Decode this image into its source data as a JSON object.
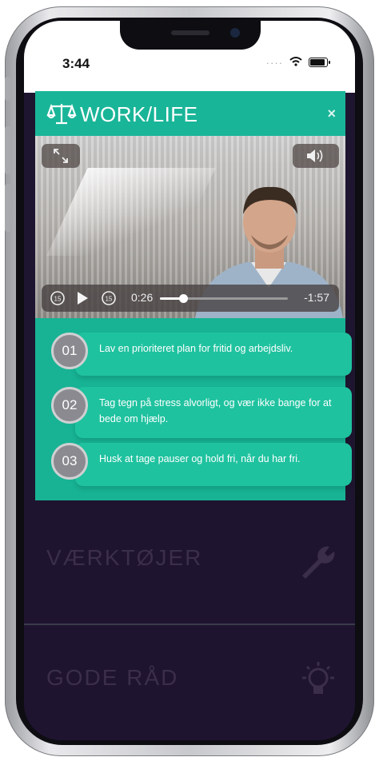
{
  "status_bar": {
    "time": "3:44"
  },
  "modal": {
    "brand": "WORK/LIFE",
    "close_label": "×",
    "video": {
      "elapsed": "0:26",
      "remaining": "-1:57",
      "progress": 0.18,
      "skip_seconds": "15"
    },
    "tips": [
      {
        "number": "01",
        "text": "Lav en prioriteret plan for fritid og arbejdsliv."
      },
      {
        "number": "02",
        "text": "Tag tegn på stress alvorligt, og vær ikke bange for at bede om hjælp."
      },
      {
        "number": "03",
        "text": "Husk at tage pauser og hold fri, når du har fri."
      }
    ]
  },
  "menu": [
    {
      "label": "VÆRKTØJER",
      "icon": "wrench-icon"
    },
    {
      "label": "GODE RÅD",
      "icon": "lightbulb-icon"
    }
  ],
  "colors": {
    "accent": "#17b394",
    "card": "#1fc29f",
    "menu_bg": "#1f1430"
  }
}
